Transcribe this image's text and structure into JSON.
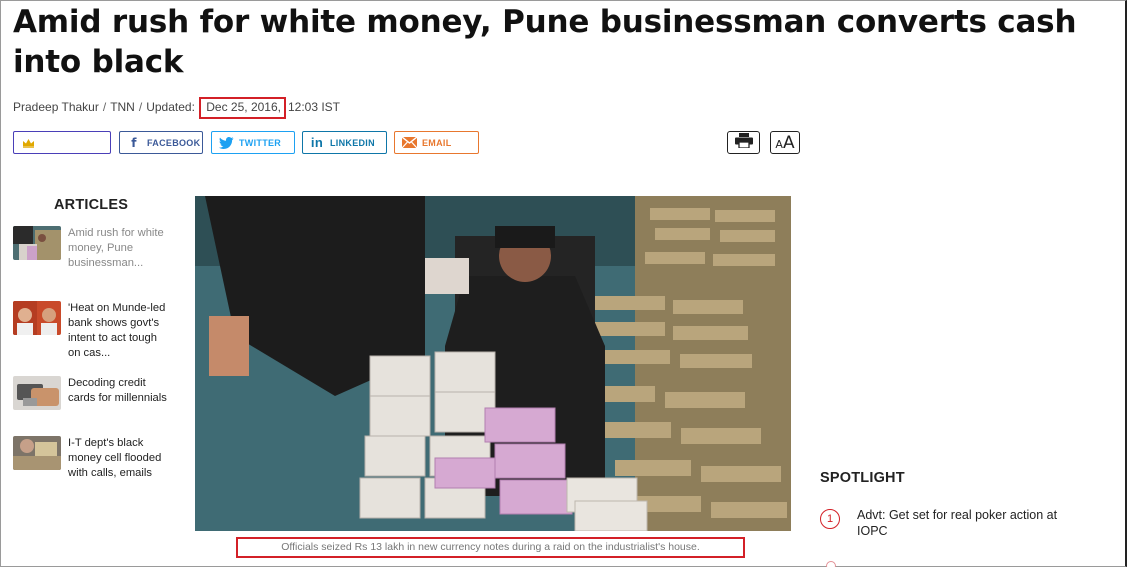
{
  "article": {
    "headline": "Amid rush for white money, Pune businessman converts cash into black",
    "byline": {
      "author": "Pradeep Thakur",
      "source": "TNN",
      "updated_label": "Updated:",
      "date": "Dec 25, 2016",
      "time": "12:03 IST"
    }
  },
  "share": {
    "crown_icon": "crown-icon",
    "facebook": "FACEBOOK",
    "twitter": "TWITTER",
    "linkedin": "LINKEDIN",
    "email": "EMAIL"
  },
  "tools": {
    "print_icon": "printer-icon",
    "font_small": "A",
    "font_big": "A"
  },
  "articles": {
    "heading": "ARTICLES",
    "items": [
      {
        "title": "Amid rush for white money, Pune businessman...",
        "current": true
      },
      {
        "title": "'Heat on Munde-led bank shows govt's intent to act tough on cas...",
        "current": false
      },
      {
        "title": "Decoding credit cards for millennials",
        "current": false
      },
      {
        "title": "I-T dept's black money cell flooded with calls, emails",
        "current": false
      }
    ]
  },
  "photo": {
    "caption": "Officials seized Rs 13 lakh in new currency notes during a raid on the industrialist's house."
  },
  "spotlight": {
    "heading": "SPOTLIGHT",
    "items": [
      {
        "number": "1",
        "title": "Advt: Get set for real poker action at IOPC"
      }
    ]
  },
  "colors": {
    "highlight_red": "#d32027",
    "facebook": "#3b5998",
    "twitter": "#1da1f2",
    "linkedin": "#0e76a8",
    "email": "#e8772e"
  }
}
